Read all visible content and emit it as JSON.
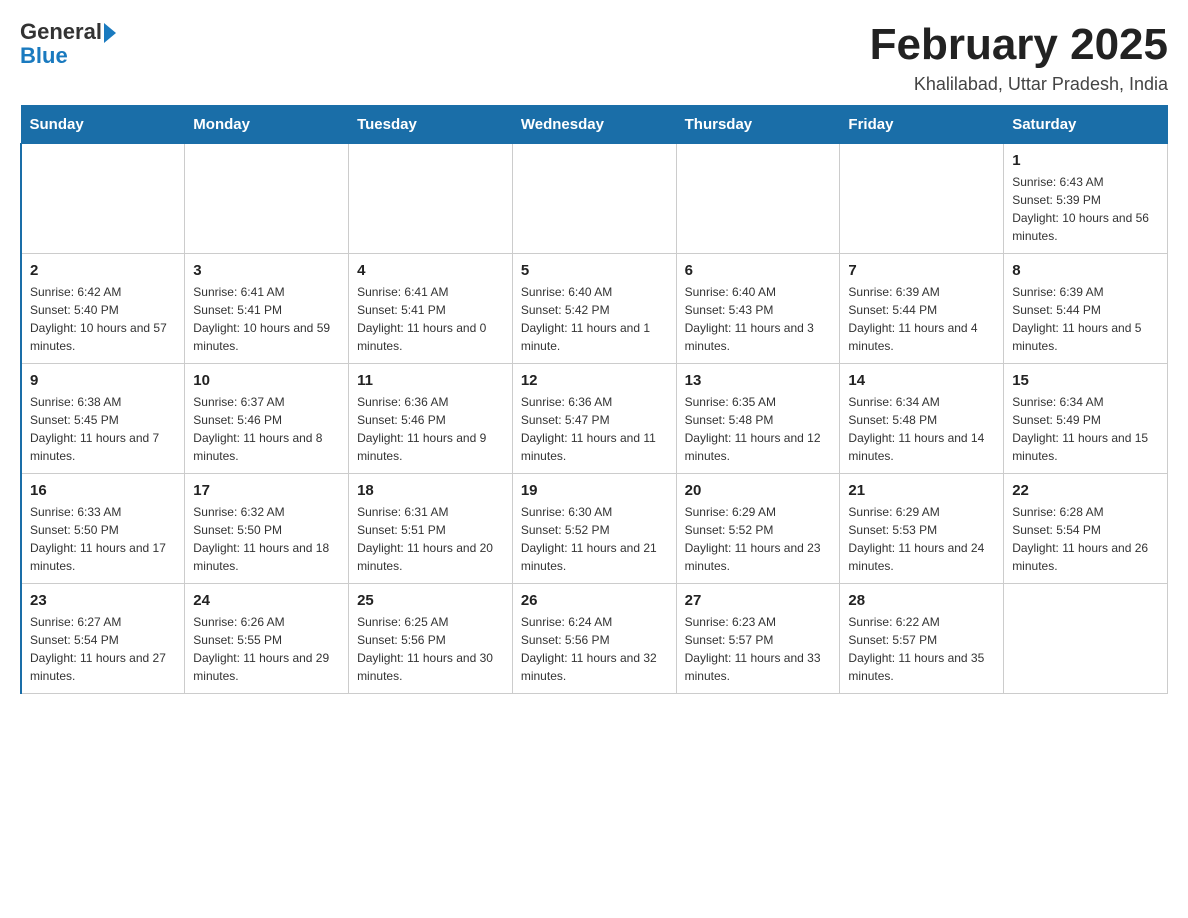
{
  "header": {
    "logo_general": "General",
    "logo_blue": "Blue",
    "title": "February 2025",
    "subtitle": "Khalilabad, Uttar Pradesh, India"
  },
  "days_of_week": [
    "Sunday",
    "Monday",
    "Tuesday",
    "Wednesday",
    "Thursday",
    "Friday",
    "Saturday"
  ],
  "weeks": [
    [
      {
        "day": "",
        "info": ""
      },
      {
        "day": "",
        "info": ""
      },
      {
        "day": "",
        "info": ""
      },
      {
        "day": "",
        "info": ""
      },
      {
        "day": "",
        "info": ""
      },
      {
        "day": "",
        "info": ""
      },
      {
        "day": "1",
        "info": "Sunrise: 6:43 AM\nSunset: 5:39 PM\nDaylight: 10 hours and 56 minutes."
      }
    ],
    [
      {
        "day": "2",
        "info": "Sunrise: 6:42 AM\nSunset: 5:40 PM\nDaylight: 10 hours and 57 minutes."
      },
      {
        "day": "3",
        "info": "Sunrise: 6:41 AM\nSunset: 5:41 PM\nDaylight: 10 hours and 59 minutes."
      },
      {
        "day": "4",
        "info": "Sunrise: 6:41 AM\nSunset: 5:41 PM\nDaylight: 11 hours and 0 minutes."
      },
      {
        "day": "5",
        "info": "Sunrise: 6:40 AM\nSunset: 5:42 PM\nDaylight: 11 hours and 1 minute."
      },
      {
        "day": "6",
        "info": "Sunrise: 6:40 AM\nSunset: 5:43 PM\nDaylight: 11 hours and 3 minutes."
      },
      {
        "day": "7",
        "info": "Sunrise: 6:39 AM\nSunset: 5:44 PM\nDaylight: 11 hours and 4 minutes."
      },
      {
        "day": "8",
        "info": "Sunrise: 6:39 AM\nSunset: 5:44 PM\nDaylight: 11 hours and 5 minutes."
      }
    ],
    [
      {
        "day": "9",
        "info": "Sunrise: 6:38 AM\nSunset: 5:45 PM\nDaylight: 11 hours and 7 minutes."
      },
      {
        "day": "10",
        "info": "Sunrise: 6:37 AM\nSunset: 5:46 PM\nDaylight: 11 hours and 8 minutes."
      },
      {
        "day": "11",
        "info": "Sunrise: 6:36 AM\nSunset: 5:46 PM\nDaylight: 11 hours and 9 minutes."
      },
      {
        "day": "12",
        "info": "Sunrise: 6:36 AM\nSunset: 5:47 PM\nDaylight: 11 hours and 11 minutes."
      },
      {
        "day": "13",
        "info": "Sunrise: 6:35 AM\nSunset: 5:48 PM\nDaylight: 11 hours and 12 minutes."
      },
      {
        "day": "14",
        "info": "Sunrise: 6:34 AM\nSunset: 5:48 PM\nDaylight: 11 hours and 14 minutes."
      },
      {
        "day": "15",
        "info": "Sunrise: 6:34 AM\nSunset: 5:49 PM\nDaylight: 11 hours and 15 minutes."
      }
    ],
    [
      {
        "day": "16",
        "info": "Sunrise: 6:33 AM\nSunset: 5:50 PM\nDaylight: 11 hours and 17 minutes."
      },
      {
        "day": "17",
        "info": "Sunrise: 6:32 AM\nSunset: 5:50 PM\nDaylight: 11 hours and 18 minutes."
      },
      {
        "day": "18",
        "info": "Sunrise: 6:31 AM\nSunset: 5:51 PM\nDaylight: 11 hours and 20 minutes."
      },
      {
        "day": "19",
        "info": "Sunrise: 6:30 AM\nSunset: 5:52 PM\nDaylight: 11 hours and 21 minutes."
      },
      {
        "day": "20",
        "info": "Sunrise: 6:29 AM\nSunset: 5:52 PM\nDaylight: 11 hours and 23 minutes."
      },
      {
        "day": "21",
        "info": "Sunrise: 6:29 AM\nSunset: 5:53 PM\nDaylight: 11 hours and 24 minutes."
      },
      {
        "day": "22",
        "info": "Sunrise: 6:28 AM\nSunset: 5:54 PM\nDaylight: 11 hours and 26 minutes."
      }
    ],
    [
      {
        "day": "23",
        "info": "Sunrise: 6:27 AM\nSunset: 5:54 PM\nDaylight: 11 hours and 27 minutes."
      },
      {
        "day": "24",
        "info": "Sunrise: 6:26 AM\nSunset: 5:55 PM\nDaylight: 11 hours and 29 minutes."
      },
      {
        "day": "25",
        "info": "Sunrise: 6:25 AM\nSunset: 5:56 PM\nDaylight: 11 hours and 30 minutes."
      },
      {
        "day": "26",
        "info": "Sunrise: 6:24 AM\nSunset: 5:56 PM\nDaylight: 11 hours and 32 minutes."
      },
      {
        "day": "27",
        "info": "Sunrise: 6:23 AM\nSunset: 5:57 PM\nDaylight: 11 hours and 33 minutes."
      },
      {
        "day": "28",
        "info": "Sunrise: 6:22 AM\nSunset: 5:57 PM\nDaylight: 11 hours and 35 minutes."
      },
      {
        "day": "",
        "info": ""
      }
    ]
  ]
}
